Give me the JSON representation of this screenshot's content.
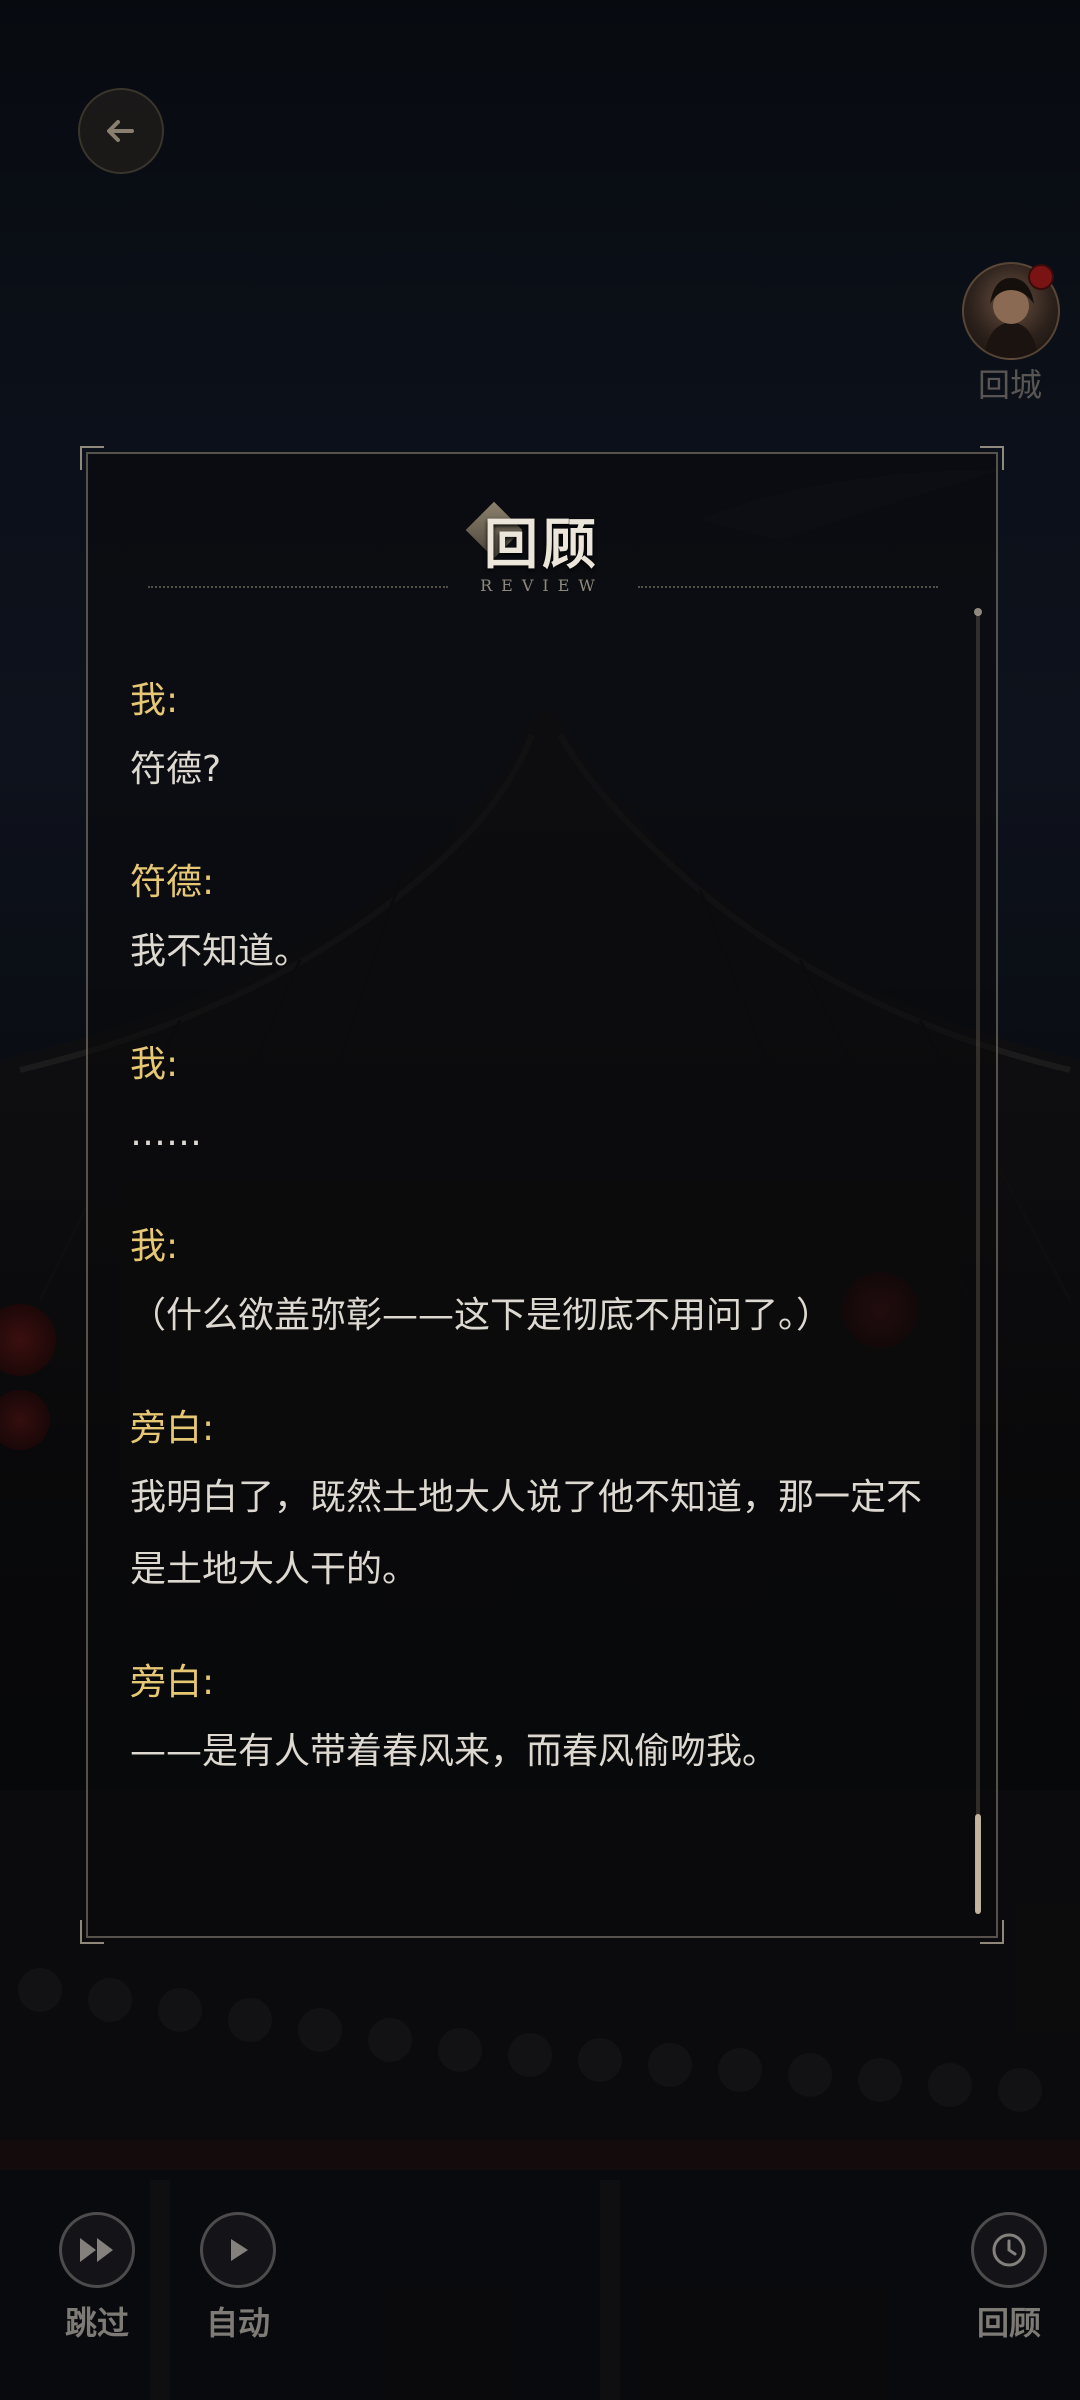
{
  "top": {
    "avatar_label": "回城"
  },
  "panel": {
    "title": "回顾",
    "subtitle": "REVIEW"
  },
  "dialogue": [
    {
      "speaker": "我:",
      "line": "符德?"
    },
    {
      "speaker": "符德:",
      "line": "我不知道。"
    },
    {
      "speaker": "我:",
      "line": "……"
    },
    {
      "speaker": "我:",
      "line": "（什么欲盖弥彰——这下是彻底不用问了。）"
    },
    {
      "speaker": "旁白:",
      "line": "我明白了，既然土地大人说了他不知道，那一定不是土地大人干的。"
    },
    {
      "speaker": "旁白:",
      "line": "——是有人带着春风来，而春风偷吻我。"
    }
  ],
  "controls": {
    "skip_label": "跳过",
    "auto_label": "自动",
    "review_label": "回顾"
  },
  "colors": {
    "speaker": "#e6c774",
    "text": "#ddd8d0",
    "panel_border": "#968c7d"
  },
  "icons": [
    "back-arrow-icon",
    "avatar-icon",
    "fast-forward-icon",
    "play-icon",
    "clock-icon"
  ]
}
